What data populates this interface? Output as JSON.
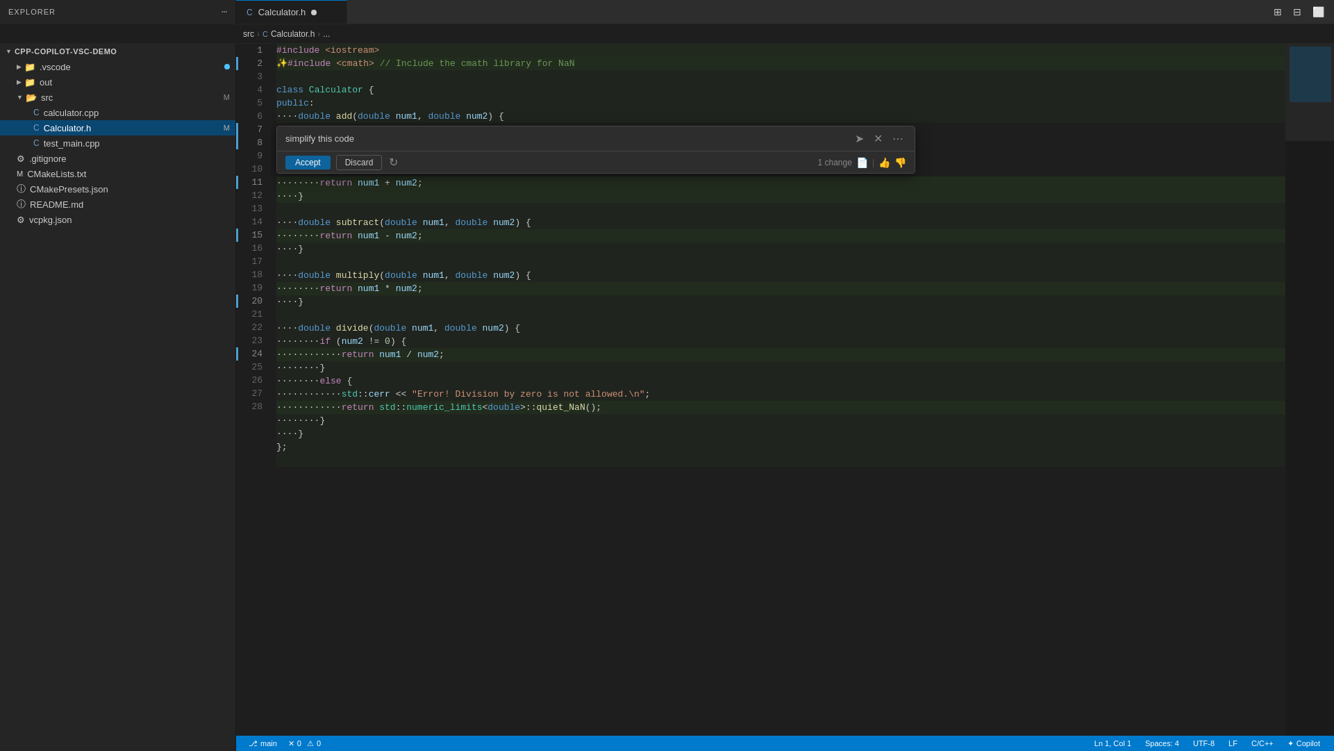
{
  "titlebar": {
    "title": "EXPLORER",
    "actions": [
      "⋯"
    ]
  },
  "tabs": [
    {
      "name": "Calculator.h",
      "modified": true,
      "active": true,
      "icon": "C"
    }
  ],
  "breadcrumb": {
    "items": [
      "src",
      "C Calculator.h",
      "..."
    ]
  },
  "sidebar": {
    "header": "EXPLORER",
    "project": "CPP-COPILOT-VSC-DEMO",
    "items": [
      {
        "label": ".vscode",
        "type": "folder",
        "indent": 1,
        "modified": false,
        "badge": ""
      },
      {
        "label": "out",
        "type": "folder",
        "indent": 1,
        "modified": false,
        "badge": ""
      },
      {
        "label": "src",
        "type": "folder",
        "indent": 1,
        "modified": false,
        "badge": "M",
        "open": true
      },
      {
        "label": "calculator.cpp",
        "type": "file-cpp",
        "indent": 2,
        "modified": false,
        "badge": ""
      },
      {
        "label": "Calculator.h",
        "type": "file-h",
        "indent": 2,
        "modified": true,
        "badge": "M",
        "active": true
      },
      {
        "label": "test_main.cpp",
        "type": "file-cpp",
        "indent": 2,
        "modified": false,
        "badge": ""
      },
      {
        "label": ".gitignore",
        "type": "file",
        "indent": 1,
        "modified": false,
        "badge": ""
      },
      {
        "label": "CMakeLists.txt",
        "type": "file-cmake",
        "indent": 1,
        "modified": false,
        "badge": ""
      },
      {
        "label": "CMakePresets.json",
        "type": "file-json",
        "indent": 1,
        "modified": false,
        "badge": ""
      },
      {
        "label": "README.md",
        "type": "file-md",
        "indent": 1,
        "modified": false,
        "badge": ""
      },
      {
        "label": "vcpkg.json",
        "type": "file-json",
        "indent": 1,
        "modified": false,
        "badge": ""
      }
    ]
  },
  "copilot": {
    "prompt": "simplify this code",
    "accept_label": "Accept",
    "discard_label": "Discard",
    "change_count": "1 change"
  },
  "code": {
    "lines": [
      {
        "num": 1,
        "content": "#include <iostream>",
        "type": "normal"
      },
      {
        "num": 2,
        "content": "#include <cmath> // Include the cmath library for NaN",
        "type": "added"
      },
      {
        "num": 3,
        "content": "",
        "type": "normal"
      },
      {
        "num": 4,
        "content": "class Calculator {",
        "type": "normal"
      },
      {
        "num": 5,
        "content": "public:",
        "type": "normal"
      },
      {
        "num": 6,
        "content": "    double add(double num1, double num2) {",
        "type": "normal"
      },
      {
        "num": 7,
        "content": "        return num1 + num2;",
        "type": "added"
      },
      {
        "num": 8,
        "content": "    }",
        "type": "added"
      },
      {
        "num": 9,
        "content": "",
        "type": "normal"
      },
      {
        "num": 10,
        "content": "    double subtract(double num1, double num2) {",
        "type": "normal"
      },
      {
        "num": 11,
        "content": "        return num1 - num2;",
        "type": "added"
      },
      {
        "num": 12,
        "content": "    }",
        "type": "normal"
      },
      {
        "num": 13,
        "content": "",
        "type": "normal"
      },
      {
        "num": 14,
        "content": "    double multiply(double num1, double num2) {",
        "type": "normal"
      },
      {
        "num": 15,
        "content": "        return num1 * num2;",
        "type": "added"
      },
      {
        "num": 16,
        "content": "    }",
        "type": "normal"
      },
      {
        "num": 17,
        "content": "",
        "type": "normal"
      },
      {
        "num": 18,
        "content": "    double divide(double num1, double num2) {",
        "type": "normal"
      },
      {
        "num": 19,
        "content": "        if (num2 != 0) {",
        "type": "normal"
      },
      {
        "num": 20,
        "content": "            return num1 / num2;",
        "type": "added"
      },
      {
        "num": 21,
        "content": "        }",
        "type": "normal"
      },
      {
        "num": 22,
        "content": "        else {",
        "type": "normal"
      },
      {
        "num": 23,
        "content": "            std::cerr << \"Error! Division by zero is not allowed.\\n\";",
        "type": "normal"
      },
      {
        "num": 24,
        "content": "            return std::numeric_limits<double>::quiet_NaN();",
        "type": "added"
      },
      {
        "num": 25,
        "content": "        }",
        "type": "normal"
      },
      {
        "num": 26,
        "content": "    }",
        "type": "normal"
      },
      {
        "num": 27,
        "content": "};",
        "type": "normal"
      },
      {
        "num": 28,
        "content": "",
        "type": "normal"
      }
    ]
  },
  "statusbar": {
    "branch": "main",
    "errors": "0",
    "warnings": "0",
    "line_col": "Ln 1, Col 1",
    "spaces": "Spaces: 4",
    "encoding": "UTF-8",
    "eol": "LF",
    "language": "C/C++",
    "copilot": "Copilot"
  }
}
